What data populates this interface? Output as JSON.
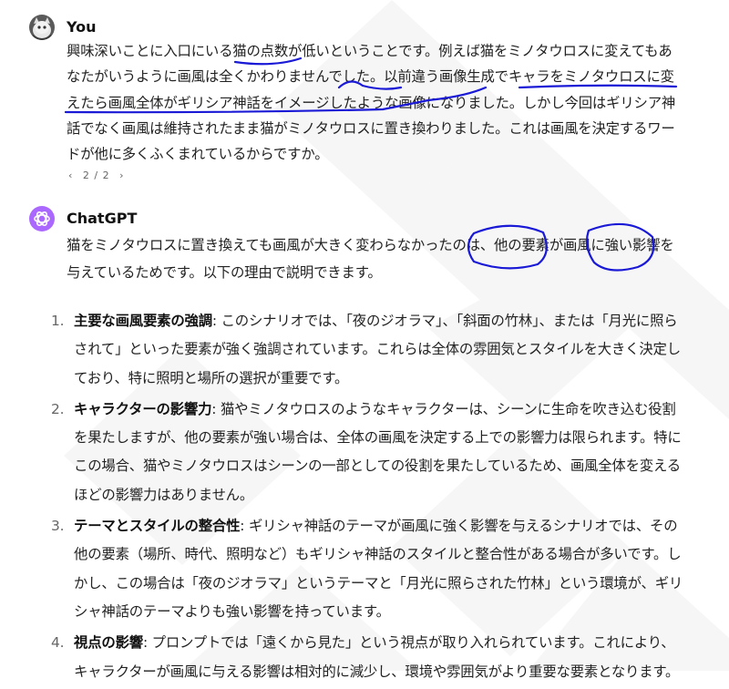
{
  "user_message": {
    "author": "You",
    "text": "興味深いことに入口にいる猫の点数が低いということです。例えば猫をミノタウロスに変えてもあなたがいうように画風は全くかわりませんでした。以前違う画像生成でキャラをミノタウロスに変えたら画風全体がギリシア神話をイメージしたような画像になりました。しかし今回はギリシア神話でなく画風は維持されたまま猫がミノタウロスに置き換わりました。これは画風を決定するワードが他に多くふくまれているからですか。",
    "pager": {
      "prev": "‹",
      "label": "2 / 2",
      "next": "›"
    }
  },
  "assistant_message": {
    "author": "ChatGPT",
    "intro": "猫をミノタウロスに置き換えても画風が大きく変わらなかったのは、他の要素が画風に強い影響を与えているためです。以下の理由で説明できます。",
    "reasons": [
      {
        "num": "1.",
        "title": "主要な画風要素の強調",
        "text": ": このシナリオでは、「夜のジオラマ」、「斜面の竹林」、または「月光に照らされて」といった要素が強く強調されています。これらは全体の雰囲気とスタイルを大きく決定しており、特に照明と場所の選択が重要です。"
      },
      {
        "num": "2.",
        "title": "キャラクターの影響力",
        "text": ": 猫やミノタウロスのようなキャラクターは、シーンに生命を吹き込む役割を果たしますが、他の要素が強い場合は、全体の画風を決定する上での影響力は限られます。特にこの場合、猫やミノタウロスはシーンの一部としての役割を果たしているため、画風全体を変えるほどの影響力はありません。"
      },
      {
        "num": "3.",
        "title": "テーマとスタイルの整合性",
        "text": ": ギリシャ神話のテーマが画風に強く影響を与えるシナリオでは、その他の要素（場所、時代、照明など）もギリシャ神話のスタイルと整合性がある場合が多いです。しかし、この場合は「夜のジオラマ」というテーマと「月光に照らされた竹林」という環境が、ギリシャ神話のテーマよりも強い影響を持っています。"
      },
      {
        "num": "4.",
        "title": "視点の影響",
        "text": ": プロンプトでは「遠くから見た」という視点が取り入れられています。これにより、キャラクターが画風に与える影響は相対的に減少し、環境や雰囲気がより重要な要素となります。"
      }
    ]
  },
  "colors": {
    "ink": "#1a1ad6",
    "accent": "#ab68ff",
    "bg": "#ffffff"
  },
  "icons": {
    "user_avatar": "cat-photo-avatar",
    "assistant_avatar": "openai-logo-icon"
  }
}
